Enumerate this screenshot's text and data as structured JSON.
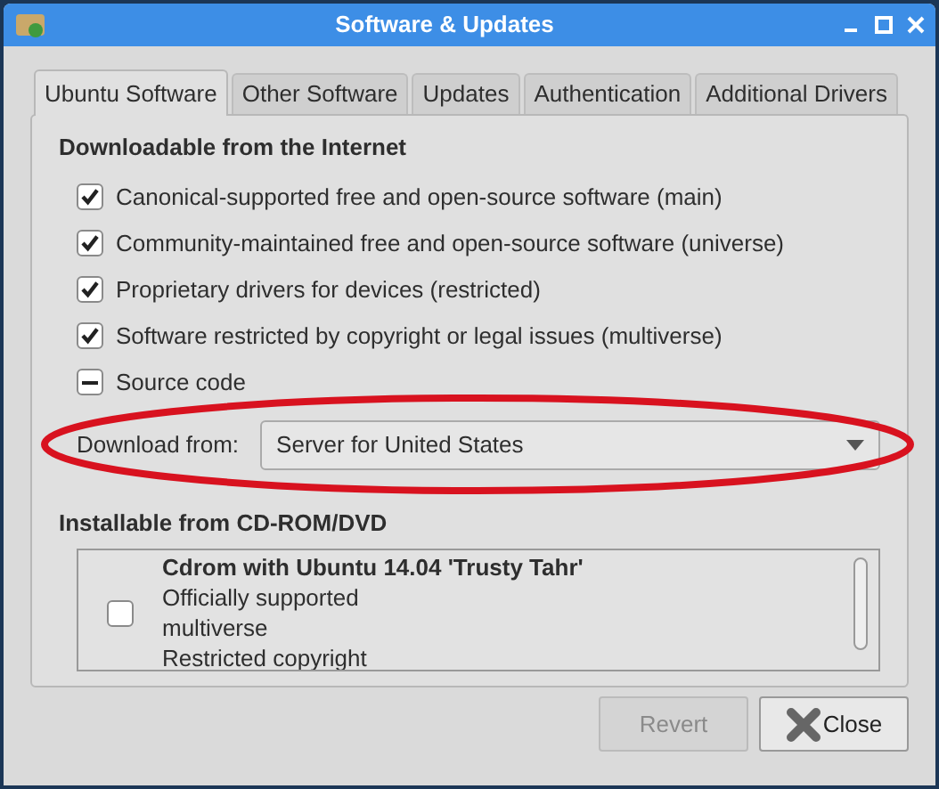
{
  "window": {
    "title": "Software & Updates"
  },
  "tabs": [
    {
      "label": "Ubuntu Software",
      "selected": true
    },
    {
      "label": "Other Software",
      "selected": false
    },
    {
      "label": "Updates",
      "selected": false
    },
    {
      "label": "Authentication",
      "selected": false
    },
    {
      "label": "Additional Drivers",
      "selected": false
    }
  ],
  "downloadable": {
    "heading": "Downloadable from the Internet",
    "options": [
      {
        "label": "Canonical-supported free and open-source software (main)",
        "checked": true,
        "indeterminate": false
      },
      {
        "label": "Community-maintained free and open-source software (universe)",
        "checked": true,
        "indeterminate": false
      },
      {
        "label": "Proprietary drivers for devices (restricted)",
        "checked": true,
        "indeterminate": false
      },
      {
        "label": "Software restricted by copyright or legal issues (multiverse)",
        "checked": true,
        "indeterminate": false
      },
      {
        "label": "Source code",
        "checked": true,
        "indeterminate": true
      }
    ],
    "download_from": {
      "label": "Download from:",
      "value": "Server for United States"
    }
  },
  "installable": {
    "heading": "Installable from CD-ROM/DVD",
    "items": [
      {
        "title": "Cdrom with Ubuntu 14.04 'Trusty Tahr'",
        "lines": [
          "Officially supported",
          "multiverse",
          "Restricted copyright"
        ],
        "checked": false
      }
    ]
  },
  "buttons": [
    {
      "label": "Revert",
      "disabled": true,
      "kind": "revert"
    },
    {
      "label": "Close",
      "disabled": false,
      "kind": "close"
    }
  ],
  "annotation": {
    "kind": "ellipse"
  }
}
